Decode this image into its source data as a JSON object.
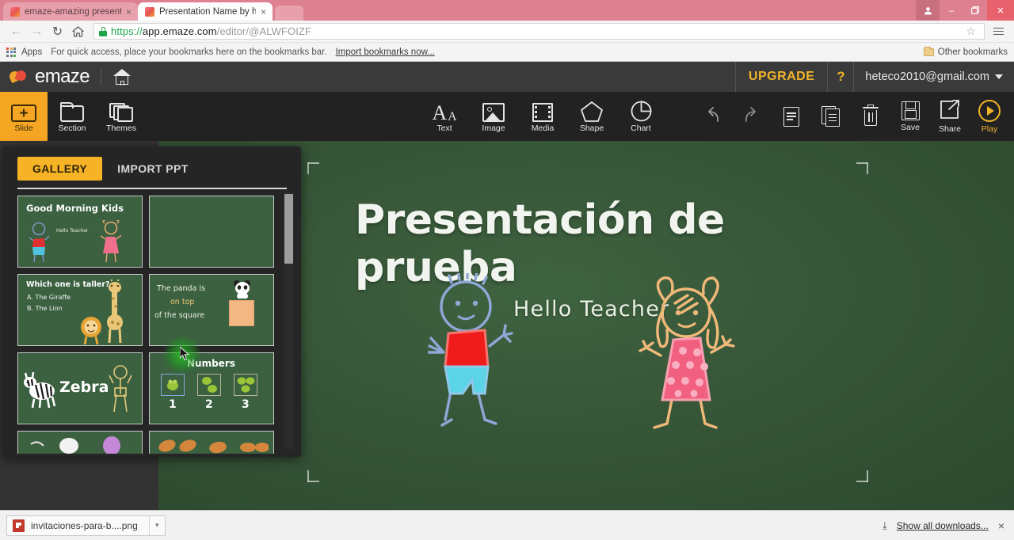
{
  "browser": {
    "tabs": [
      {
        "title": "emaze-amazing presenta",
        "active": false,
        "close": "×"
      },
      {
        "title": "Presentation Name by he",
        "active": true,
        "close": "×"
      }
    ],
    "window_controls": {
      "person": "●",
      "minimize": "–",
      "maximize": "❐",
      "close": "×"
    },
    "nav": {
      "back": "←",
      "forward": "→",
      "reload": "↻",
      "home": "⌂",
      "star": "☆"
    },
    "url": {
      "scheme": "https://",
      "host": "app.emaze.com",
      "path": "/editor/@ALWFOIZF"
    },
    "bookmarks": {
      "apps_label": "Apps",
      "hint": "For quick access, place your bookmarks here on the bookmarks bar.",
      "import_link": "Import bookmarks now...",
      "other": "Other bookmarks"
    }
  },
  "app_header": {
    "brand": "emaze",
    "upgrade_label": "UPGRADE",
    "help_label": "?",
    "account_email": "heteco2010@gmail.com"
  },
  "toolbar": {
    "left_tools": [
      {
        "label": "Slide",
        "icon": "plus-slide-icon",
        "active": true
      },
      {
        "label": "Section",
        "icon": "folder-icon",
        "active": false
      },
      {
        "label": "Themes",
        "icon": "themes-stack-icon",
        "active": false
      }
    ],
    "insert_tools": [
      {
        "label": "Text",
        "icon": "text-aa-icon"
      },
      {
        "label": "Image",
        "icon": "image-icon"
      },
      {
        "label": "Media",
        "icon": "media-film-icon"
      },
      {
        "label": "Shape",
        "icon": "pentagon-shape-icon"
      },
      {
        "label": "Chart",
        "icon": "pie-chart-icon"
      }
    ],
    "action_tools": [
      {
        "label": "",
        "icon": "undo-arrow-icon"
      },
      {
        "label": "",
        "icon": "redo-arrow-icon"
      },
      {
        "label": "",
        "icon": "copy-doc-icon"
      },
      {
        "label": "",
        "icon": "paste-doc-icon"
      },
      {
        "label": "",
        "icon": "trash-icon"
      },
      {
        "label": "Save",
        "icon": "save-floppy-icon"
      },
      {
        "label": "Share",
        "icon": "share-export-icon"
      },
      {
        "label": "Play",
        "icon": "play-circle-icon"
      }
    ]
  },
  "gallery": {
    "tabs": [
      {
        "label": "GALLERY",
        "active": true
      },
      {
        "label": "IMPORT PPT",
        "active": false
      }
    ],
    "thumbnails": [
      {
        "name": "good-morning-kids",
        "title": "Good Morning Kids",
        "caption": "Hello Teacher"
      },
      {
        "name": "blank-slide",
        "title": "",
        "caption": ""
      },
      {
        "name": "which-one-is-taller",
        "title": "Which one is taller?",
        "option_a": "A. The Giraffe",
        "option_b": "B. The Lion"
      },
      {
        "name": "panda-on-top",
        "line1": "The panda is",
        "line2": "on top",
        "line3": "of the square"
      },
      {
        "name": "zebra",
        "title": "Zebra"
      },
      {
        "name": "numbers",
        "title": "Numbers",
        "numbers": [
          "1",
          "2",
          "3"
        ]
      },
      {
        "name": "partial-slide-left",
        "title": ""
      },
      {
        "name": "partial-slide-right",
        "title": ""
      }
    ]
  },
  "slide": {
    "title": "Presentación de prueba",
    "hello_text": "Hello  Teacher",
    "figures": [
      {
        "name": "boy-chalk-figure",
        "outline_color": "#8fa8d8",
        "shirt_color": "#f01c1c",
        "shorts_color": "#5ad4e6"
      },
      {
        "name": "girl-chalk-figure",
        "outline_color": "#f0b97a",
        "dress_color": "#f2607f",
        "dots_color": "#f9aec2"
      }
    ]
  },
  "downloads": {
    "file_name": "invitaciones-para-b....png",
    "caret": "▾",
    "show_all": "Show all downloads...",
    "close": "×",
    "download_icon": "⤓"
  },
  "colors": {
    "accent_amber": "#f5a623",
    "upgrade_gold": "#f0b429",
    "chalkboard_green": "#3b6140",
    "toolbar_dark": "#222222",
    "panel_dark": "#252525",
    "tab_pink": "#dd8090"
  }
}
